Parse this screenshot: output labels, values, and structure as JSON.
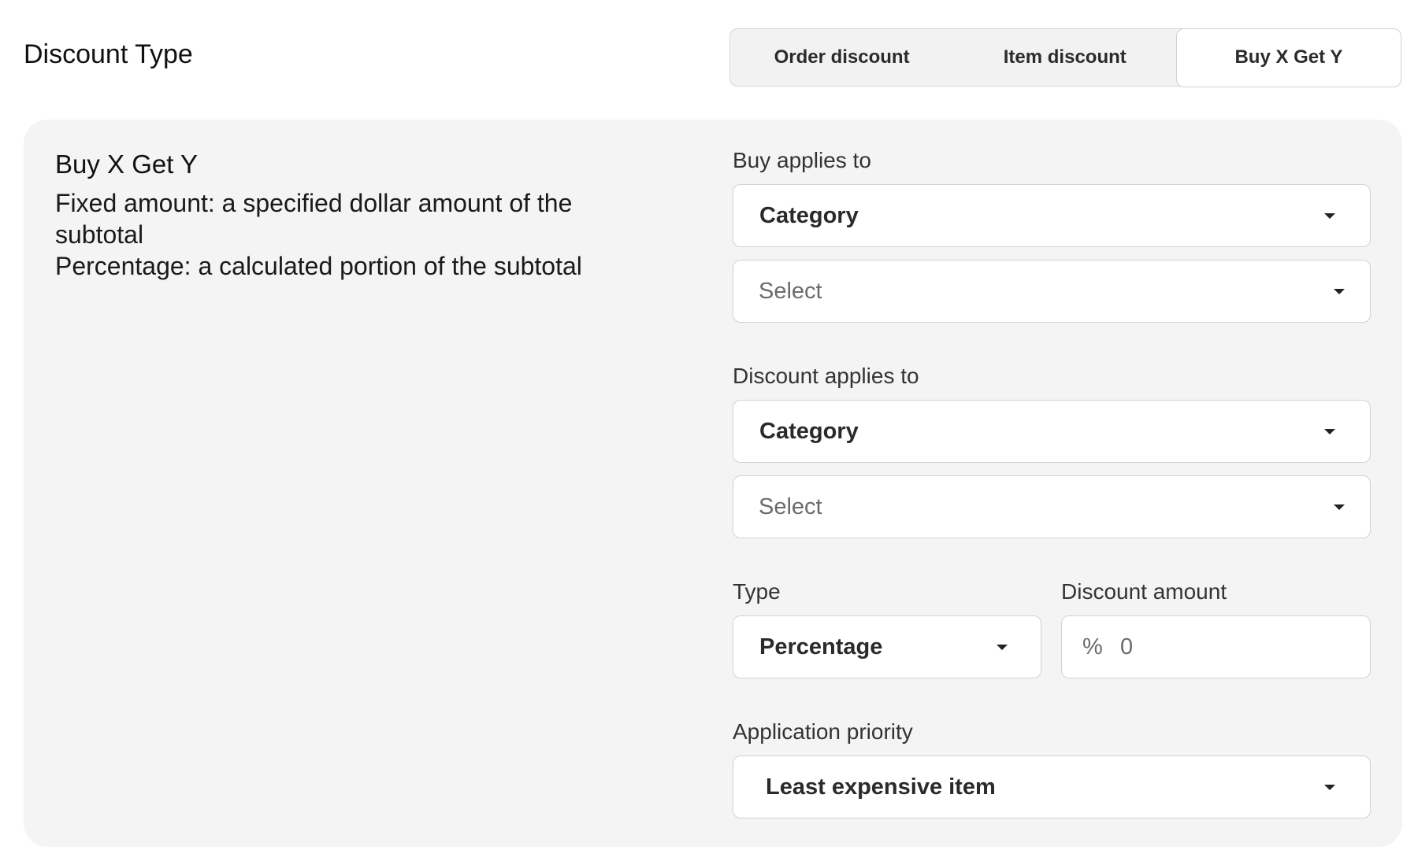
{
  "header": {
    "title": "Discount Type"
  },
  "tabs": [
    {
      "label": "Order discount",
      "active": false
    },
    {
      "label": "Item discount",
      "active": false
    },
    {
      "label": "Buy X Get Y",
      "active": true
    }
  ],
  "info": {
    "title": "Buy X Get Y",
    "line1": "Fixed amount: a specified dollar amount of the subtotal",
    "line2": "Percentage: a calculated portion of the subtotal"
  },
  "form": {
    "buy_applies_to": {
      "label": "Buy applies to",
      "value": "Category",
      "select_placeholder": "Select"
    },
    "discount_applies_to": {
      "label": "Discount applies to",
      "value": "Category",
      "select_placeholder": "Select"
    },
    "type": {
      "label": "Type",
      "value": "Percentage"
    },
    "discount_amount": {
      "label": "Discount amount",
      "prefix": "%",
      "value": "0"
    },
    "application_priority": {
      "label": "Application priority",
      "value": "Least expensive item"
    }
  }
}
